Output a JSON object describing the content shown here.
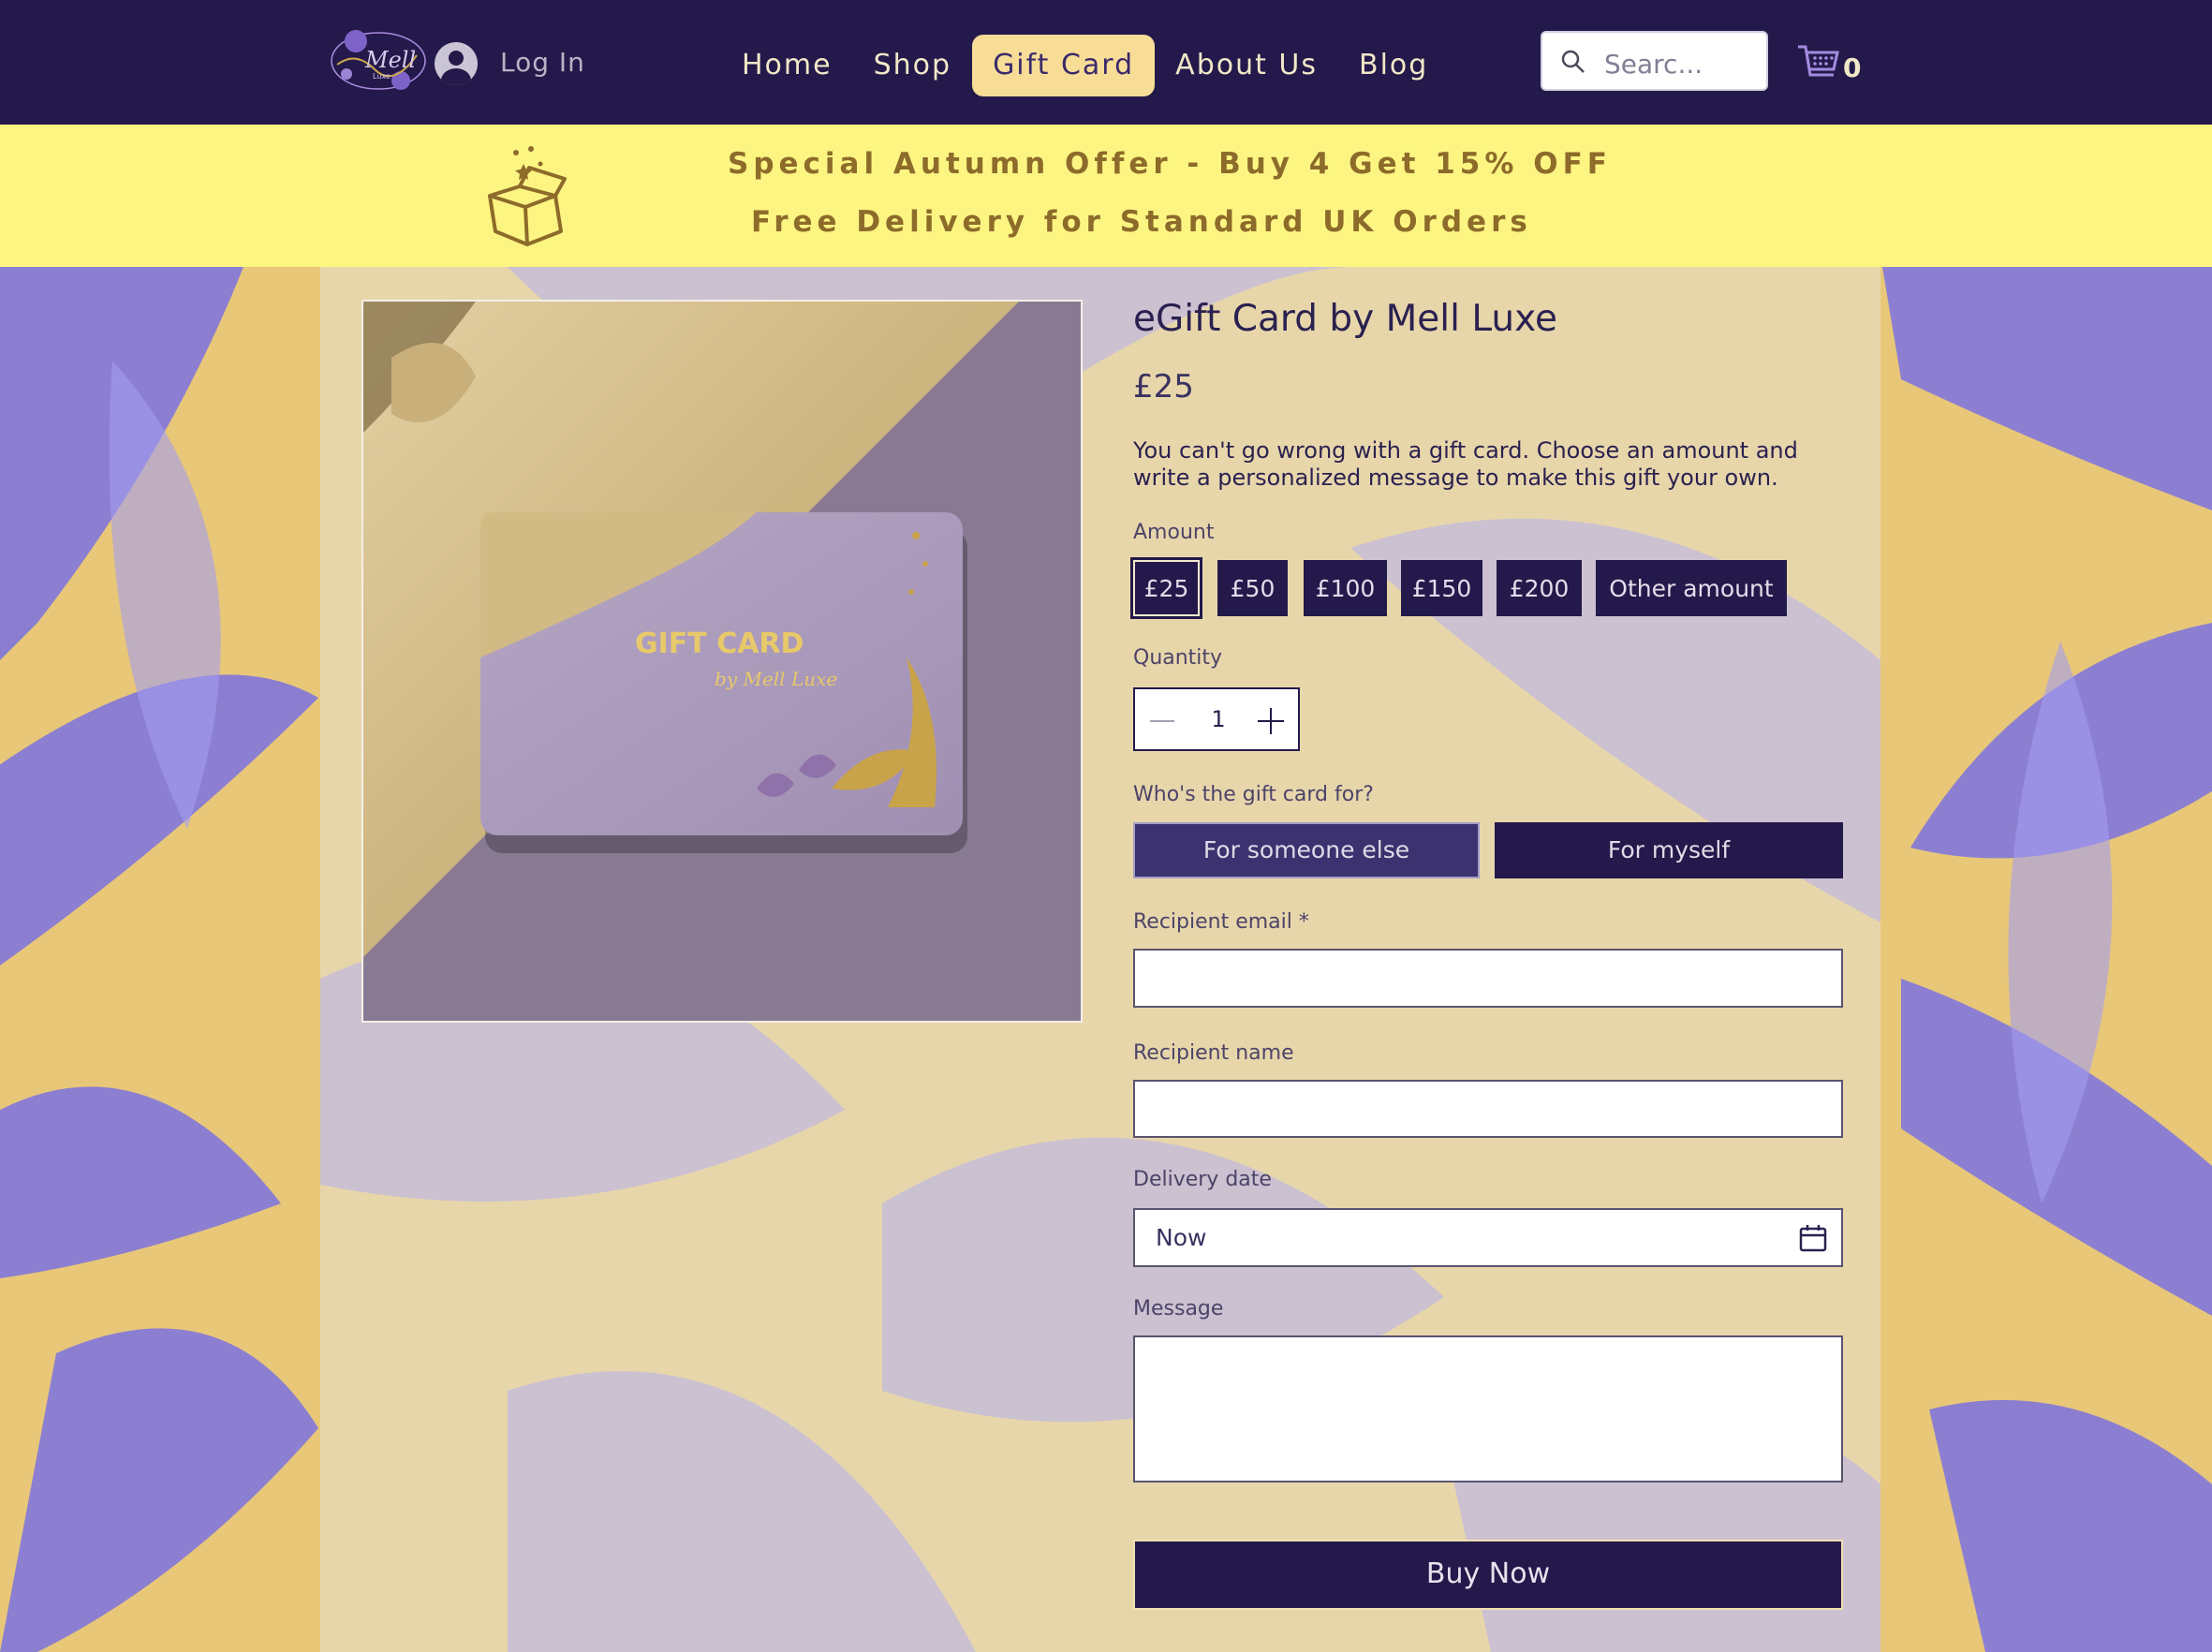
{
  "header": {
    "logo_alt": "Mell Luxe logo",
    "login_label": "Log In",
    "nav": [
      {
        "label": "Home",
        "active": false
      },
      {
        "label": "Shop",
        "active": false
      },
      {
        "label": "Gift Card",
        "active": true
      },
      {
        "label": "About Us",
        "active": false
      },
      {
        "label": "Blog",
        "active": false
      }
    ],
    "search_placeholder": "Searc...",
    "cart_count": "0"
  },
  "banner": {
    "line1": "Special Autumn Offer - Buy 4 Get 15% OFF",
    "line2": "Free Delivery for Standard UK Orders"
  },
  "product": {
    "image": {
      "card_title": "GIFT CARD",
      "card_subtitle": "by Mell Luxe"
    },
    "title": "eGift Card by Mell Luxe",
    "price": "£25",
    "description": "You can't go wrong with a gift card. Choose an amount and write a personalized message to make this gift your own.",
    "amount_label": "Amount",
    "amounts": [
      {
        "label": "£25",
        "selected": true
      },
      {
        "label": "£50",
        "selected": false
      },
      {
        "label": "£100",
        "selected": false
      },
      {
        "label": "£150",
        "selected": false
      },
      {
        "label": "£200",
        "selected": false
      },
      {
        "label": "Other amount",
        "selected": false
      }
    ],
    "quantity_label": "Quantity",
    "quantity": "1",
    "recipient_question": "Who's the gift card for?",
    "for_someone_label": "For someone else",
    "for_myself_label": "For myself",
    "recipient_email_label": "Recipient email *",
    "recipient_email_value": "",
    "recipient_name_label": "Recipient name",
    "recipient_name_value": "",
    "delivery_date_label": "Delivery date",
    "delivery_date_value": "Now",
    "message_label": "Message",
    "message_value": "",
    "buy_label": "Buy Now"
  },
  "colors": {
    "header_bg": "#23194a",
    "banner_bg": "#fcf582",
    "banner_text": "#8d6b2a",
    "active_nav": "#f8dd97",
    "button_dark": "#23194a"
  }
}
